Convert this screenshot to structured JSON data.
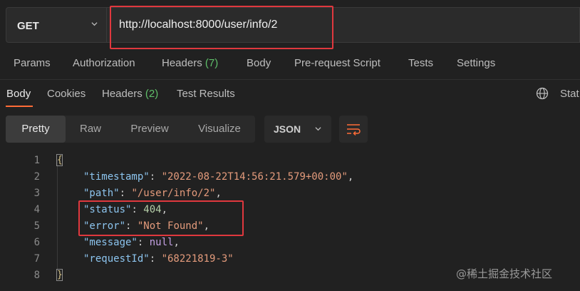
{
  "request": {
    "method": "GET",
    "url": "http://localhost:8000/user/info/2"
  },
  "request_tabs": [
    {
      "label": "Params"
    },
    {
      "label": "Authorization"
    },
    {
      "label": "Headers",
      "count": "(7)"
    },
    {
      "label": "Body"
    },
    {
      "label": "Pre-request Script"
    },
    {
      "label": "Tests"
    },
    {
      "label": "Settings"
    }
  ],
  "response_tabs": [
    {
      "label": "Body"
    },
    {
      "label": "Cookies"
    },
    {
      "label": "Headers",
      "count": "(2)"
    },
    {
      "label": "Test Results"
    }
  ],
  "status_truncated": "Stat",
  "format_buttons": [
    "Pretty",
    "Raw",
    "Preview",
    "Visualize"
  ],
  "language": "JSON",
  "code": {
    "line_numbers": [
      "1",
      "2",
      "3",
      "4",
      "5",
      "6",
      "7",
      "8"
    ],
    "open_brace": "{",
    "close_brace": "}",
    "fields": [
      {
        "key": "\"timestamp\"",
        "value": "\"2022-08-22T14:56:21.579+00:00\"",
        "type": "str"
      },
      {
        "key": "\"path\"",
        "value": "\"/user/info/2\"",
        "type": "str"
      },
      {
        "key": "\"status\"",
        "value": "404",
        "type": "num"
      },
      {
        "key": "\"error\"",
        "value": "\"Not Found\"",
        "type": "str"
      },
      {
        "key": "\"message\"",
        "value": "null",
        "type": "nul"
      },
      {
        "key": "\"requestId\"",
        "value": "\"68221819-3\"",
        "type": "str"
      }
    ]
  },
  "watermark": "@稀土掘金技术社区",
  "colors": {
    "accent": "#ff6c37",
    "highlight_box": "#e0383e",
    "count_green": "#5fbf6a"
  }
}
